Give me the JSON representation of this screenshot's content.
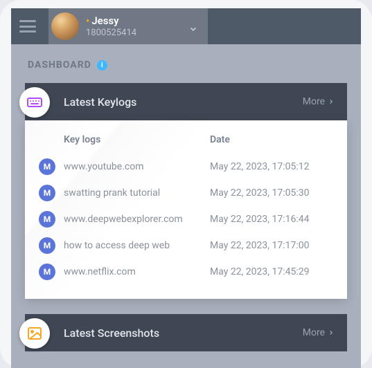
{
  "profile": {
    "name": "Jessy",
    "sub": "1800525414"
  },
  "page_title": "DASHBOARD",
  "keylogs_card": {
    "title": "Latest Keylogs",
    "more": "More",
    "col1": "Key logs",
    "col2": "Date",
    "rows": [
      {
        "icon": "M",
        "text": "www.youtube.com",
        "date": "May 22, 2023, 17:05:12"
      },
      {
        "icon": "M",
        "text": "swatting prank tutorial",
        "date": "May 22, 2023, 17:05:30"
      },
      {
        "icon": "M",
        "text": "www.deepwebexplorer.com",
        "date": "May 22, 2023, 17:16:44"
      },
      {
        "icon": "M",
        "text": "how to access deep web",
        "date": "May 22, 2023, 17:17:00"
      },
      {
        "icon": "M",
        "text": "www.netflix.com",
        "date": "May 22, 2023, 17:45:29"
      }
    ]
  },
  "screenshots_card": {
    "title": "Latest Screenshots",
    "more": "More"
  }
}
